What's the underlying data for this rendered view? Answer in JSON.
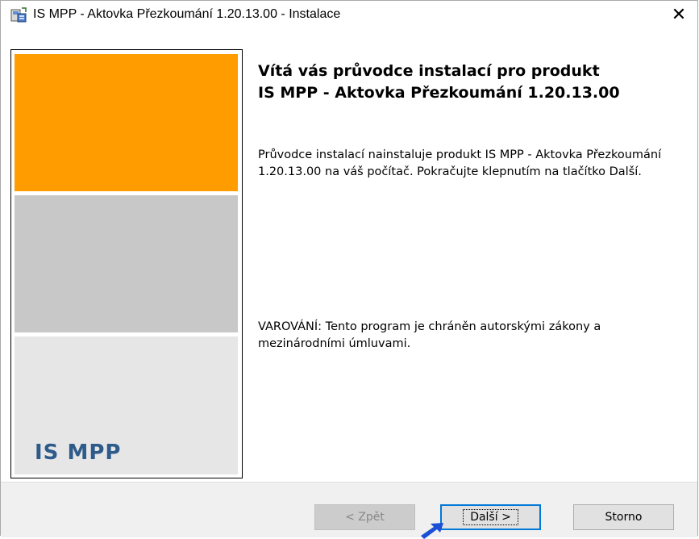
{
  "window": {
    "title": "IS MPP - Aktovka Přezkoumání 1.20.13.00 - Instalace",
    "close_glyph": "✕",
    "icon": "installer-icon"
  },
  "banner": {
    "brand": "IS MPP",
    "colors": {
      "top": "#ff9c00",
      "middle": "#c8c8c8",
      "bottom": "#e6e6e6",
      "brand_text": "#2f5b8b"
    }
  },
  "content": {
    "heading_line1": "Vítá vás průvodce instalací pro produkt",
    "heading_line2": "IS MPP - Aktovka Přezkoumání 1.20.13.00",
    "intro": "Průvodce instalací nainstaluje produkt IS MPP - Aktovka Přezkoumání 1.20.13.00 na váš počítač. Pokračujte klepnutím na tlačítko Další.",
    "warning": "VAROVÁNÍ: Tento program je chráněn autorskými zákony a mezinárodními úmluvami."
  },
  "buttons": {
    "back": "< Zpět",
    "next": "Další >",
    "cancel": "Storno"
  }
}
